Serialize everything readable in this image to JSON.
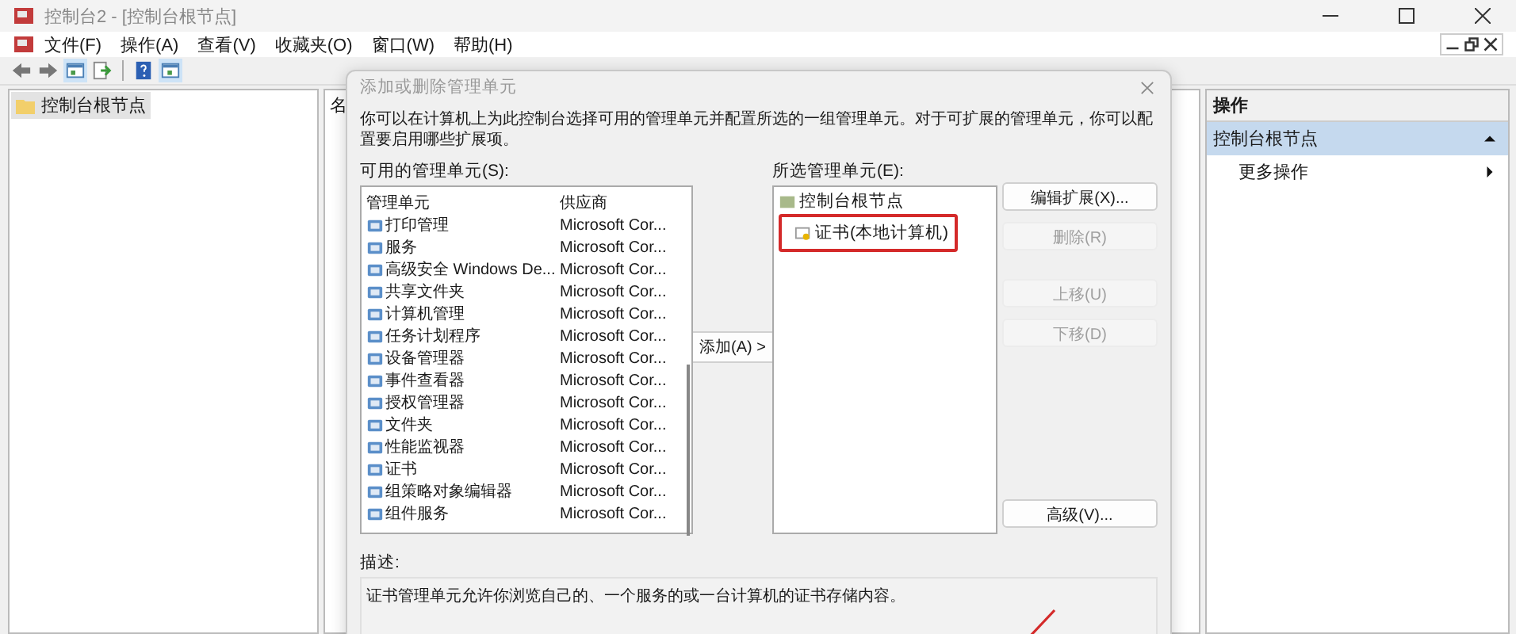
{
  "window": {
    "title": "控制台2 - [控制台根节点]"
  },
  "menu": [
    "文件(F)",
    "操作(A)",
    "查看(V)",
    "收藏夹(O)",
    "窗口(W)",
    "帮助(H)"
  ],
  "tree": [
    {
      "label": "控制台根节点",
      "selected": true
    }
  ],
  "center_pane": {
    "column_1": "名"
  },
  "actions_pane": {
    "title": "操作",
    "items": [
      {
        "label": "控制台根节点",
        "kind": "header"
      },
      {
        "label": "更多操作",
        "kind": "submenu"
      }
    ]
  },
  "dialog": {
    "title": "添加或删除管理单元",
    "intro": "你可以在计算机上为此控制台选择可用的管理单元并配置所选的一组管理单元。对于可扩展的管理单元，你可以配置要启用哪些扩展项。",
    "available_label": "可用的管理单元(S):",
    "columns": [
      "管理单元",
      "供应商"
    ],
    "rows": [
      {
        "name": "打印管理",
        "vendor": "Microsoft Cor..."
      },
      {
        "name": "服务",
        "vendor": "Microsoft Cor..."
      },
      {
        "name": "高级安全 Windows De...",
        "vendor": "Microsoft Cor..."
      },
      {
        "name": "共享文件夹",
        "vendor": "Microsoft Cor..."
      },
      {
        "name": "计算机管理",
        "vendor": "Microsoft Cor..."
      },
      {
        "name": "任务计划程序",
        "vendor": "Microsoft Cor..."
      },
      {
        "name": "设备管理器",
        "vendor": "Microsoft Cor..."
      },
      {
        "name": "事件查看器",
        "vendor": "Microsoft Cor..."
      },
      {
        "name": "授权管理器",
        "vendor": "Microsoft Cor..."
      },
      {
        "name": "文件夹",
        "vendor": "Microsoft Cor..."
      },
      {
        "name": "性能监视器",
        "vendor": "Microsoft Cor..."
      },
      {
        "name": "证书",
        "vendor": "Microsoft Cor..."
      },
      {
        "name": "组策略对象编辑器",
        "vendor": "Microsoft Cor..."
      },
      {
        "name": "组件服务",
        "vendor": "Microsoft Cor..."
      }
    ],
    "add_button": "添加(A) >",
    "selected_label": "所选管理单元(E):",
    "selected_tree": [
      {
        "label": "控制台根节点",
        "children": [
          {
            "label": "证书(本地计算机)",
            "highlighted": true
          }
        ]
      }
    ],
    "buttons": [
      {
        "label": "编辑扩展(X)...",
        "disabled": false,
        "kind": "top"
      },
      {
        "label": "删除(R)",
        "disabled": true,
        "kind": "top"
      },
      {
        "label": "上移(U)",
        "disabled": true,
        "kind": "move"
      },
      {
        "label": "下移(D)",
        "disabled": true,
        "kind": "move"
      },
      {
        "label": "高级(V)...",
        "disabled": false,
        "kind": "bottom"
      }
    ],
    "description_label": "描述:",
    "description": "证书管理单元允许你浏览自己的、一个服务的或一台计算机的证书存储内容。"
  }
}
